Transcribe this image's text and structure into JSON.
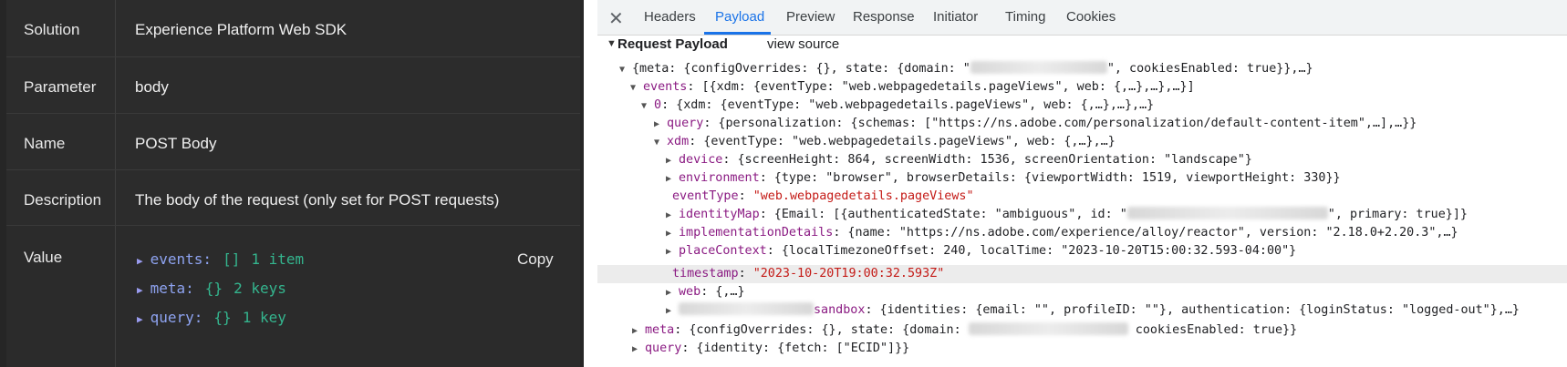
{
  "left_panel": {
    "rows": [
      {
        "key": "Solution",
        "value": "Experience Platform Web SDK"
      },
      {
        "key": "Parameter",
        "value": "body"
      },
      {
        "key": "Name",
        "value": "POST Body"
      },
      {
        "key": "Description",
        "value": "The body of the request (only set for POST requests)"
      }
    ],
    "value_row": {
      "key": "Value",
      "copy_label": "Copy",
      "tree": [
        {
          "key": "events:",
          "bracket": "[]",
          "count": "1 item"
        },
        {
          "key": "meta:",
          "bracket": "{}",
          "count": "2 keys"
        },
        {
          "key": "query:",
          "bracket": "{}",
          "count": "1 key"
        }
      ]
    }
  },
  "devtools": {
    "close_icon": "close-icon",
    "tabs": [
      "Headers",
      "Payload",
      "Preview",
      "Response",
      "Initiator",
      "Timing",
      "Cookies"
    ],
    "active_tab": "Payload",
    "section_title": "Request Payload",
    "view_source_label": "view source",
    "lines": {
      "l1": "{meta: {configOverrides: {}, state: {domain: \"",
      "l1b": "\", cookiesEnabled: true}},…}",
      "l2k": "events",
      "l2": ": [{xdm: {eventType: \"web.webpagedetails.pageViews\", web: {,…},…},…}]",
      "l3k": "0",
      "l3": ": {xdm: {eventType: \"web.webpagedetails.pageViews\", web: {,…},…},…}",
      "l4k": "query",
      "l4": ": {personalization: {schemas: [\"https://ns.adobe.com/personalization/default-content-item\",…],…}}",
      "l5k": "xdm",
      "l5": ": {eventType: \"web.webpagedetails.pageViews\", web: {,…},…}",
      "l6k": "device",
      "l6": ": {screenHeight: 864, screenWidth: 1536, screenOrientation: \"landscape\"}",
      "l7k": "environment",
      "l7": ": {type: \"browser\", browserDetails: {viewportWidth: 1519, viewportHeight: 330}}",
      "l8k": "eventType",
      "l8": "\"web.webpagedetails.pageViews\"",
      "l9k": "identityMap",
      "l9": ": {Email: [{authenticatedState: \"ambiguous\", id: \"",
      "l9b": "\", primary: true}]}",
      "l10k": "implementationDetails",
      "l10": ": {name: \"https://ns.adobe.com/experience/alloy/reactor\", version: \"2.18.0+2.20.3\",…}",
      "l11k": "placeContext",
      "l11": ": {localTimezoneOffset: 240, localTime: \"2023-10-20T15:00:32.593-04:00\"}",
      "l12k": "timestamp",
      "l12": "\"2023-10-20T19:00:32.593Z\"",
      "l13k": "web",
      "l13": ": {,…}",
      "l14k": "sandbox",
      "l14": ": {identities: {email: \"\", profileID: \"\"}, authentication: {loginStatus: \"logged-out\"},…}",
      "l15k": "meta",
      "l15": ": {configOverrides: {}, state: {domain: ",
      "l15b": " cookiesEnabled: true}}",
      "l16k": "query",
      "l16": ": {identity: {fetch: [\"ECID\"]}}"
    }
  }
}
